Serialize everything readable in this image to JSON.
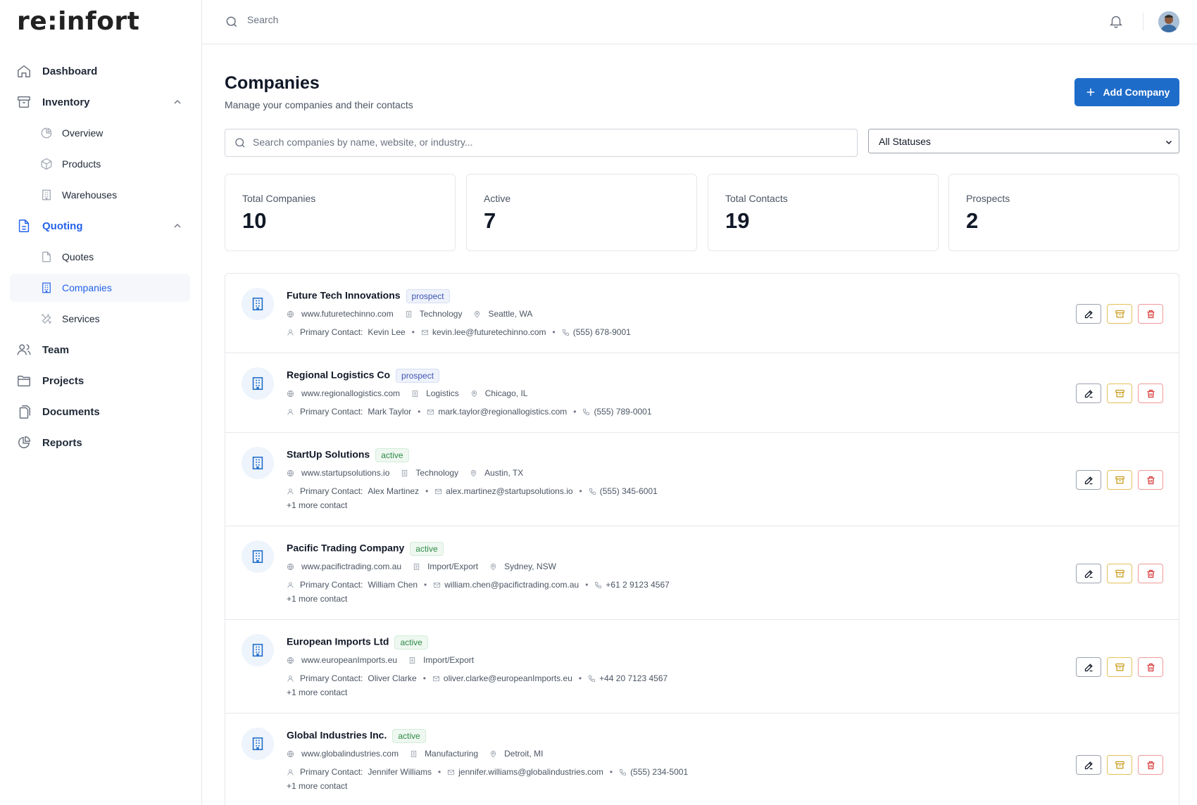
{
  "app": {
    "logo": "re:infort"
  },
  "sidebar": {
    "items": [
      {
        "label": "Dashboard",
        "icon": "home-icon"
      },
      {
        "label": "Inventory",
        "icon": "archive-icon",
        "expanded": true
      },
      {
        "label": "Overview",
        "icon": "pie-chart-icon",
        "sub": true
      },
      {
        "label": "Products",
        "icon": "box-icon",
        "sub": true
      },
      {
        "label": "Warehouses",
        "icon": "building-icon",
        "sub": true
      },
      {
        "label": "Quoting",
        "icon": "document-icon",
        "expanded": true
      },
      {
        "label": "Quotes",
        "icon": "file-icon",
        "sub": true
      },
      {
        "label": "Companies",
        "icon": "building-icon",
        "sub": true,
        "active": true
      },
      {
        "label": "Services",
        "icon": "tools-icon",
        "sub": true
      },
      {
        "label": "Team",
        "icon": "users-icon"
      },
      {
        "label": "Projects",
        "icon": "folder-icon"
      },
      {
        "label": "Documents",
        "icon": "documents-icon"
      },
      {
        "label": "Reports",
        "icon": "pie-chart-icon"
      }
    ]
  },
  "topbar": {
    "search_placeholder": "Search"
  },
  "page": {
    "title": "Companies",
    "subtitle": "Manage your companies and their contacts",
    "add_button": "Add Company",
    "search_placeholder": "Search companies by name, website, or industry...",
    "status_filter": "All Statuses"
  },
  "stats": [
    {
      "label": "Total Companies",
      "value": "10"
    },
    {
      "label": "Active",
      "value": "7"
    },
    {
      "label": "Total Contacts",
      "value": "19"
    },
    {
      "label": "Prospects",
      "value": "2"
    }
  ],
  "companies": [
    {
      "name": "Future Tech Innovations",
      "status": "prospect",
      "website": "www.futuretechinno.com",
      "industry": "Technology",
      "location": "Seattle, WA",
      "contact_label": "Primary Contact:",
      "contact": "Kevin Lee",
      "email": "kevin.lee@futuretechinno.com",
      "phone": "(555) 678-9001",
      "more": ""
    },
    {
      "name": "Regional Logistics Co",
      "status": "prospect",
      "website": "www.regionallogistics.com",
      "industry": "Logistics",
      "location": "Chicago, IL",
      "contact_label": "Primary Contact:",
      "contact": "Mark Taylor",
      "email": "mark.taylor@regionallogistics.com",
      "phone": "(555) 789-0001",
      "more": ""
    },
    {
      "name": "StartUp Solutions",
      "status": "active",
      "website": "www.startupsolutions.io",
      "industry": "Technology",
      "location": "Austin, TX",
      "contact_label": "Primary Contact:",
      "contact": "Alex Martinez",
      "email": "alex.martinez@startupsolutions.io",
      "phone": "(555) 345-6001",
      "more": "+1 more contact"
    },
    {
      "name": "Pacific Trading Company",
      "status": "active",
      "website": "www.pacifictrading.com.au",
      "industry": "Import/Export",
      "location": "Sydney, NSW",
      "contact_label": "Primary Contact:",
      "contact": "William Chen",
      "email": "william.chen@pacifictrading.com.au",
      "phone": "+61 2 9123 4567",
      "more": "+1 more contact"
    },
    {
      "name": "European Imports Ltd",
      "status": "active",
      "website": "www.europeanImports.eu",
      "industry": "Import/Export",
      "location": "",
      "contact_label": "Primary Contact:",
      "contact": "Oliver Clarke",
      "email": "oliver.clarke@europeanImports.eu",
      "phone": "+44 20 7123 4567",
      "more": "+1 more contact"
    },
    {
      "name": "Global Industries Inc.",
      "status": "active",
      "website": "www.globalindustries.com",
      "industry": "Manufacturing",
      "location": "Detroit, MI",
      "contact_label": "Primary Contact:",
      "contact": "Jennifer Williams",
      "email": "jennifer.williams@globalindustries.com",
      "phone": "(555) 234-5001",
      "more": "+1 more contact"
    }
  ],
  "colors": {
    "accent": "#1e6cc9",
    "prospect": "#4054b2",
    "active": "#2f8a47",
    "archive": "#c99a16",
    "delete": "#d93a3a"
  }
}
